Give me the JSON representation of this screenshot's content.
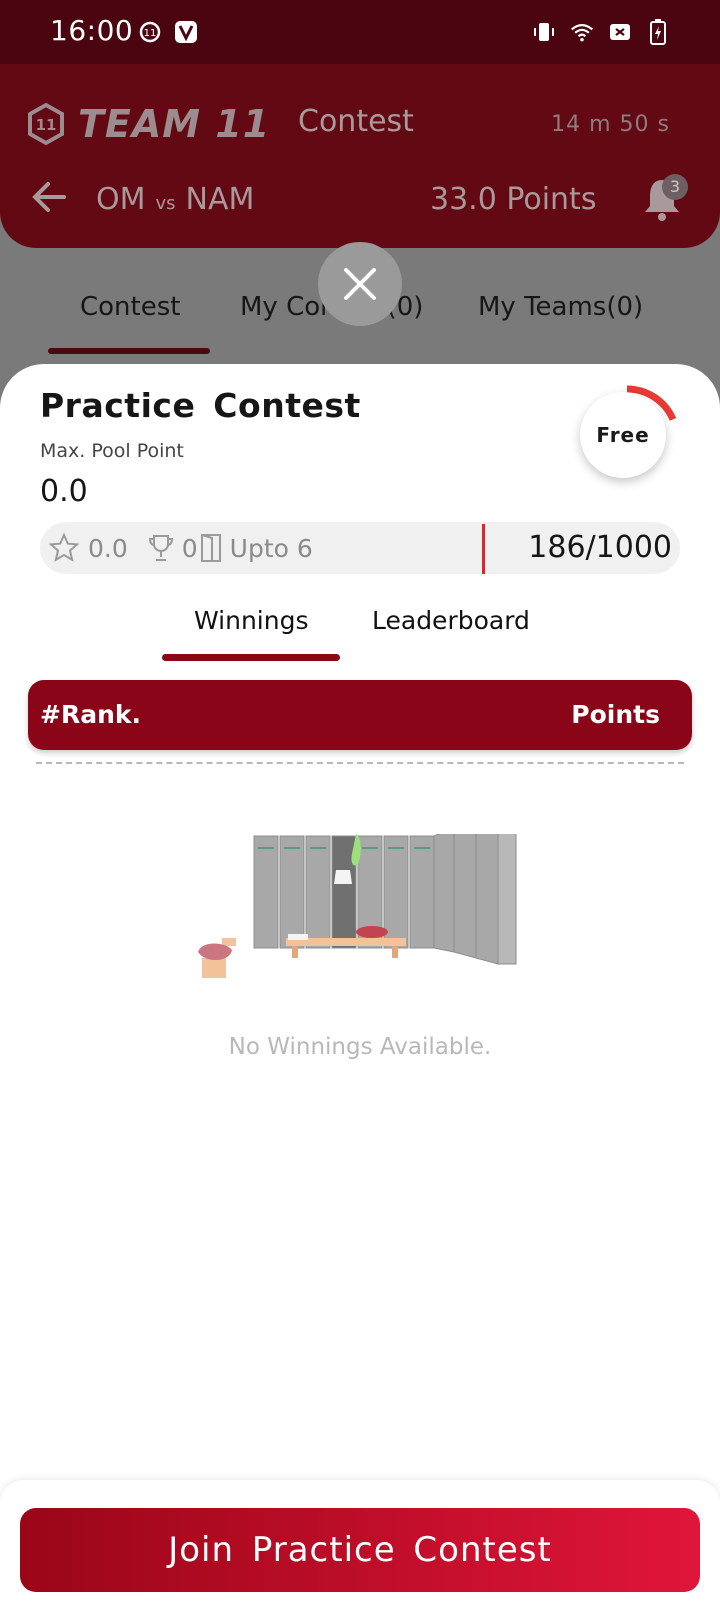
{
  "status_bar": {
    "time": "16:00",
    "left_icons": [
      "team11-app-icon",
      "v-app-icon"
    ],
    "right_icons": [
      "vibrate-icon",
      "wifi-icon",
      "no-sim-icon",
      "battery-charging-icon"
    ]
  },
  "header": {
    "logo_text": "TEAM 11",
    "title": "Contest",
    "timer": "14 m  50 s",
    "team_a": "OM",
    "vs": "vs",
    "team_b": "NAM",
    "points": "33.0 Points",
    "notification_count": "3"
  },
  "bg_tabs": [
    {
      "label": "Contest"
    },
    {
      "label": "My Contest(0)"
    },
    {
      "label": "My Teams(0)"
    }
  ],
  "contest": {
    "title": "Practice  Contest",
    "pool_label": "Max. Pool Point",
    "pool_value": "0.0",
    "fee_label": "Free",
    "fill_fraction": 0.186,
    "stats": {
      "star_value": "0.0",
      "trophy_value": "0",
      "team_limit": "Upto 6"
    },
    "entries": "186/1000"
  },
  "inner_tabs": [
    {
      "label": "Winnings"
    },
    {
      "label": "Leaderboard"
    }
  ],
  "table": {
    "rank_header": "#Rank.",
    "points_header": "Points"
  },
  "empty_state": {
    "message": "No Winnings Available."
  },
  "footer": {
    "join_label": "Join Practice  Contest"
  },
  "colors": {
    "brand": "#8b0518",
    "accent": "#e0153a",
    "ring": "#e83a34"
  }
}
